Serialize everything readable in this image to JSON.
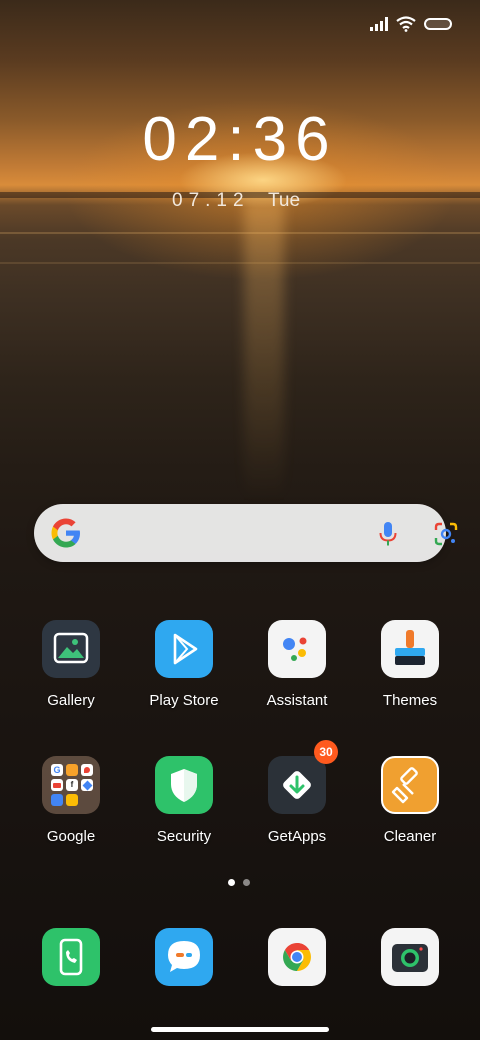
{
  "status_bar": {
    "signal_icon": "signal-bars-icon",
    "wifi_icon": "wifi-icon",
    "battery_icon": "battery-icon"
  },
  "clock": {
    "time": "02:36",
    "date": "07.12",
    "day": "Tue"
  },
  "search": {
    "google_icon": "google-g-icon",
    "mic_icon": "microphone-icon",
    "lens_icon": "google-lens-icon"
  },
  "apps": [
    {
      "label": "Gallery",
      "icon": "gallery-icon"
    },
    {
      "label": "Play Store",
      "icon": "play-store-icon"
    },
    {
      "label": "Assistant",
      "icon": "assistant-icon"
    },
    {
      "label": "Themes",
      "icon": "themes-icon"
    },
    {
      "label": "Google",
      "icon": "google-folder-icon"
    },
    {
      "label": "Security",
      "icon": "security-icon"
    },
    {
      "label": "GetApps",
      "icon": "getapps-icon",
      "badge": "30"
    },
    {
      "label": "Cleaner",
      "icon": "cleaner-icon"
    }
  ],
  "page_indicator": {
    "pages": 2,
    "current": 1
  },
  "dock": [
    {
      "icon": "phone-icon"
    },
    {
      "icon": "messages-icon"
    },
    {
      "icon": "chrome-icon"
    },
    {
      "icon": "camera-icon"
    }
  ],
  "colors": {
    "badge": "#ff5a1e",
    "play_store": "#2fa8f0",
    "security": "#2ec26a",
    "cleaner": "#f0a030",
    "phone": "#2ec26a",
    "messages": "#2fa8f0"
  }
}
